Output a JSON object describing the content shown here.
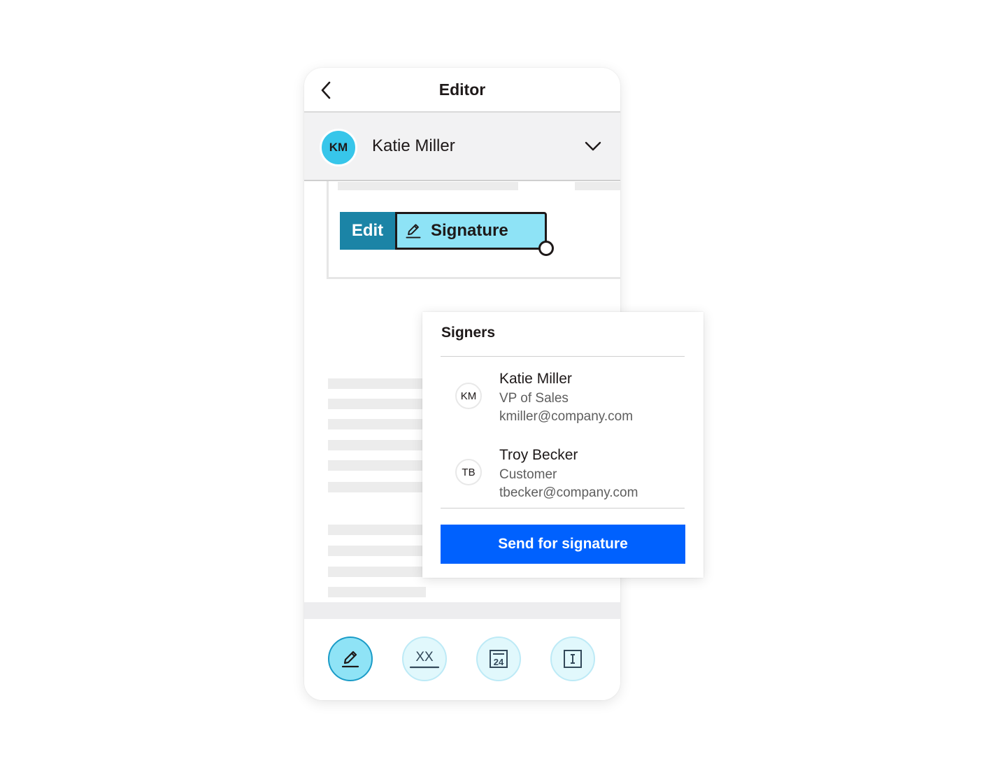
{
  "header": {
    "title": "Editor",
    "back_icon": "chevron-left-icon"
  },
  "current_signer": {
    "initials": "KM",
    "name": "Katie Miller",
    "avatar_color": "#37c6ea"
  },
  "field": {
    "edit_label": "Edit",
    "signature_label": "Signature",
    "icon": "pen-icon"
  },
  "signers_panel": {
    "title": "Signers",
    "signers": [
      {
        "initials": "KM",
        "name": "Katie Miller",
        "role": "VP of Sales",
        "email": "kmiller@company.com"
      },
      {
        "initials": "TB",
        "name": "Troy Becker",
        "role": "Customer",
        "email": "tbecker@company.com"
      }
    ],
    "send_label": "Send for signature",
    "send_color": "#0061fe"
  },
  "toolbar": {
    "tools": [
      {
        "icon": "signature-pen-icon",
        "active": true
      },
      {
        "icon": "initials-icon",
        "label": "XX",
        "active": false
      },
      {
        "icon": "date-icon",
        "label": "24",
        "active": false
      },
      {
        "icon": "text-field-icon",
        "active": false
      }
    ]
  },
  "colors": {
    "accent": "#1b84a6",
    "field_fill": "#8ee3f6",
    "primary": "#0061fe"
  }
}
